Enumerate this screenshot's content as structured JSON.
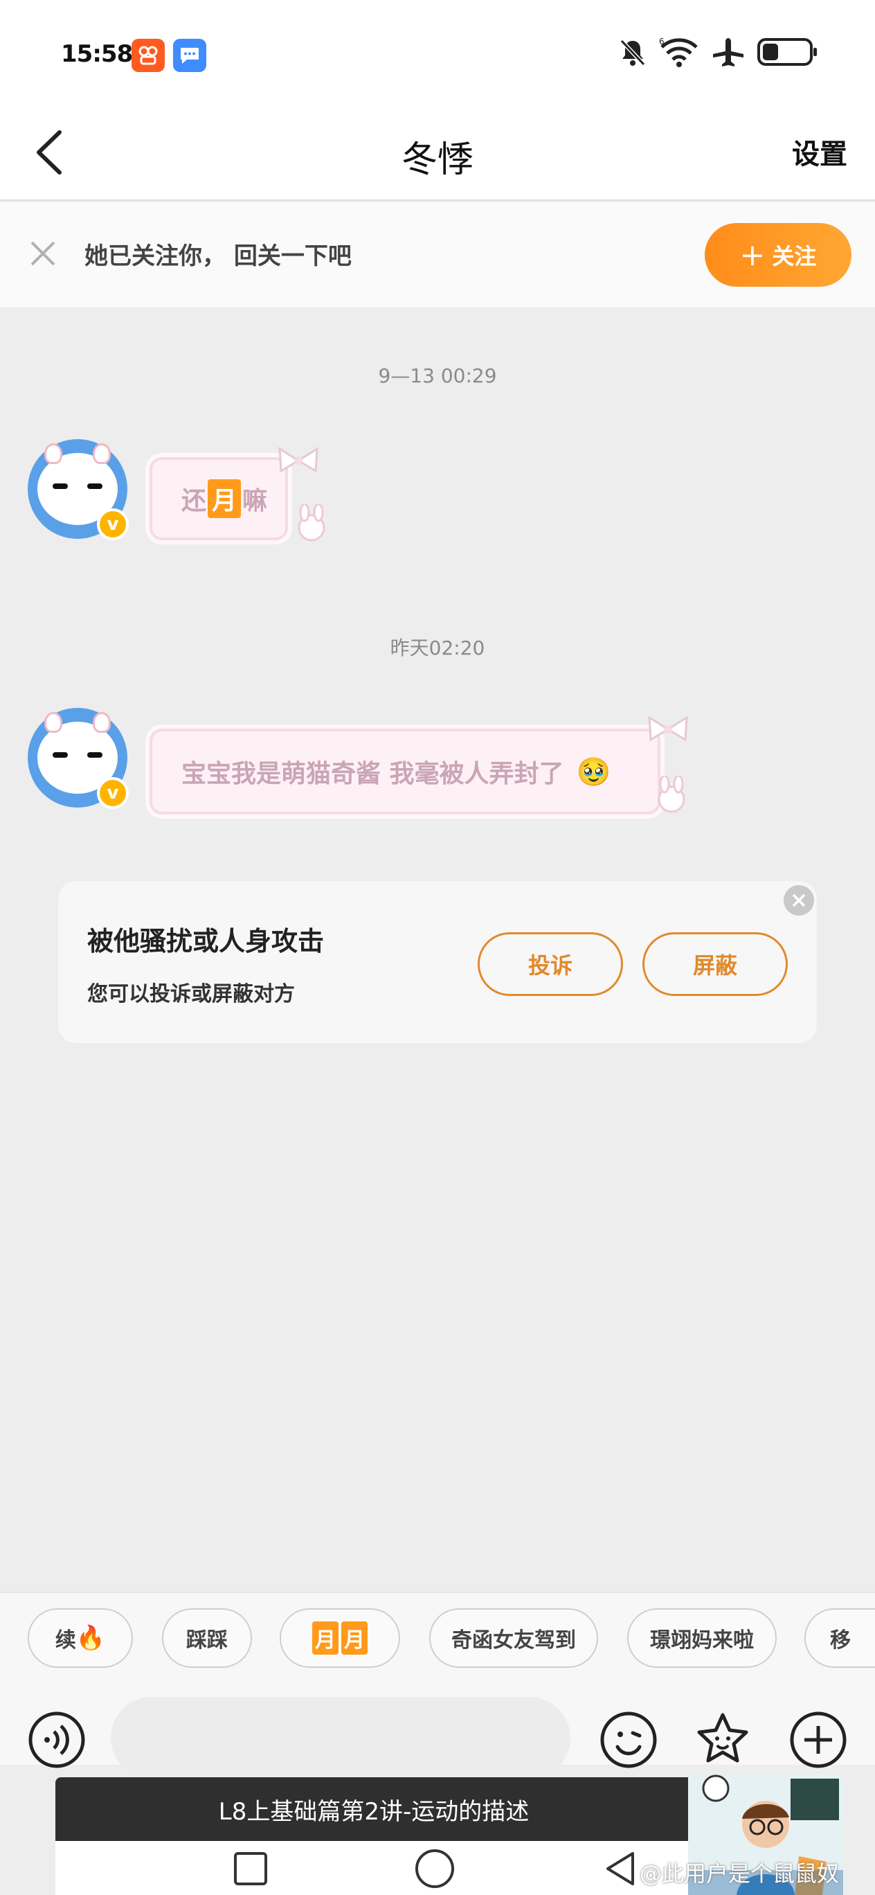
{
  "status_bar": {
    "time": "15:58",
    "icons": [
      "kuaishou-app-icon",
      "message-app-icon",
      "mute-bell-icon",
      "wifi-icon",
      "airplane-icon",
      "battery-icon"
    ]
  },
  "header": {
    "title": "冬悸",
    "settings_label": "设置"
  },
  "follow_bar": {
    "message": "她已关注你， 回关一下吧",
    "follow_button_label": "关注",
    "follow_button_icon": "+"
  },
  "chat": {
    "messages": [
      {
        "timestamp": "9—13 00:29",
        "text_before": "还",
        "text_highlight": "月",
        "text_after": "嘛"
      },
      {
        "timestamp": "昨天02:20",
        "text": "宝宝我是萌猫奇酱 我毫被人弄封了",
        "emoji": "🥹"
      }
    ],
    "avatar_badge": "v"
  },
  "report_card": {
    "title": "被他骚扰或人身攻击",
    "subtitle": "您可以投诉或屏蔽对方",
    "complain_label": "投诉",
    "block_label": "屏蔽"
  },
  "quick_replies": {
    "items": [
      {
        "text": "续",
        "emoji": "🔥"
      },
      {
        "text": "踩踩"
      },
      {
        "highlight": [
          "月",
          "月"
        ]
      },
      {
        "text": "奇函女友驾到"
      },
      {
        "text": "璟翊妈来啦"
      },
      {
        "text": "移"
      }
    ]
  },
  "course_banner": {
    "title": "L8上基础篇第2讲-运动的描述"
  },
  "watermark": "@此用户是个鼠鼠奴",
  "colors": {
    "accent": "#ff9a1a",
    "background": "#ededed",
    "bubble_text": "#c9a5b5",
    "outline_orange": "#e2892a"
  }
}
